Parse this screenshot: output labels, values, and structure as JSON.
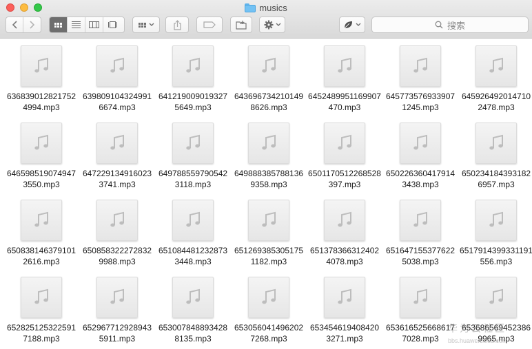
{
  "window": {
    "title": "musics",
    "folder_icon": "folder-icon"
  },
  "toolbar": {
    "back_icon": "chevron-left-icon",
    "forward_icon": "chevron-right-icon",
    "views": [
      "icon-view-icon",
      "list-view-icon",
      "column-view-icon",
      "cover-flow-icon"
    ],
    "arrange_icon": "arrange-grid-icon",
    "share_icon": "share-icon",
    "tags_icon": "tag-icon",
    "new_folder_icon": "new-folder-icon",
    "action_icon": "gear-icon",
    "app_icon": "leaf-icon",
    "search": {
      "placeholder": "搜索",
      "icon": "search-icon"
    }
  },
  "files": [
    "6368390128217524994.mp3",
    "6398091043249916674.mp3",
    "6412190090193275649.mp3",
    "6436967342101498626.mp3",
    "6452489951169907470.mp3",
    "6457735769339071245.mp3",
    "6459264920147102478.mp3",
    "6465985190749473550.mp3",
    "6472291349160233741.mp3",
    "6497885597905423118.mp3",
    "6498883857881369358.mp3",
    "6501170512268528397.mp3",
    "6502263604179143438.mp3",
    "6502341843931826957.mp3",
    "6508381463791012616.mp3",
    "6508583222728329988.mp3",
    "6510844812328733448.mp3",
    "6512693853051751182.mp3",
    "6513783663124024078.mp3",
    "6516471553776225038.mp3",
    "6517914399331191556.mp3",
    "6528251253225917188.mp3",
    "6529677129289435911.mp3",
    "6530078488934288135.mp3",
    "6530560414962027268.mp3",
    "6534546194084203271.mp3",
    "6536165256686177028.mp3",
    "6536865694523869965.mp3"
  ],
  "file_icon": "music-note-icon",
  "watermark": {
    "text": "华为云社区",
    "url": "bbs.huaweicloud.com"
  }
}
